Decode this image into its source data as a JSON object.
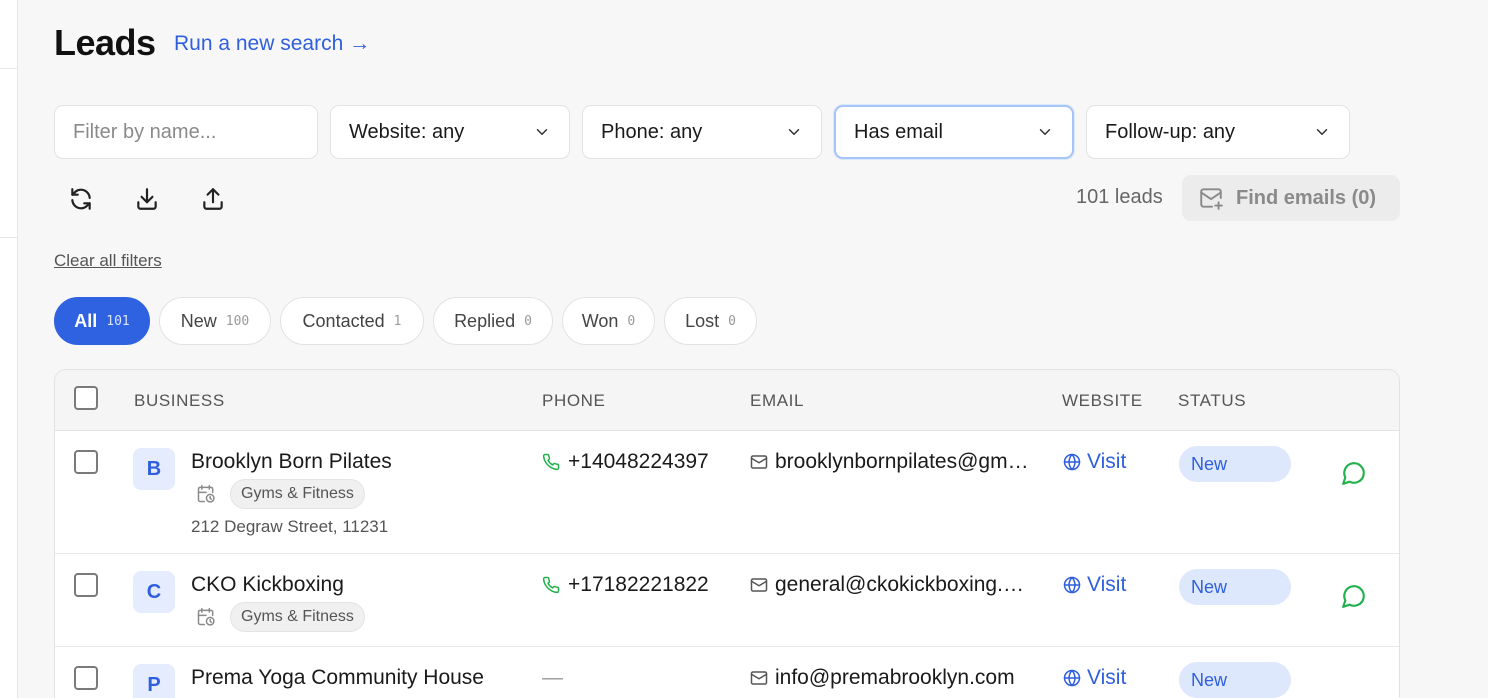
{
  "page": {
    "title": "Leads",
    "run_link": "Run a new search →"
  },
  "filters": {
    "name_placeholder": "Filter by name...",
    "website": "Website: any",
    "phone": "Phone: any",
    "email": "Has email",
    "followup": "Follow-up: any"
  },
  "toolbar": {
    "count": "101 leads",
    "find_emails": "Find emails (0)"
  },
  "clear_filters": "Clear all filters",
  "tabs": [
    {
      "label": "All",
      "count": "101"
    },
    {
      "label": "New",
      "count": "100"
    },
    {
      "label": "Contacted",
      "count": "1"
    },
    {
      "label": "Replied",
      "count": "0"
    },
    {
      "label": "Won",
      "count": "0"
    },
    {
      "label": "Lost",
      "count": "0"
    }
  ],
  "table": {
    "headers": {
      "business": "BUSINESS",
      "phone": "PHONE",
      "email": "EMAIL",
      "website": "WEBSITE",
      "status": "STATUS"
    },
    "rows": [
      {
        "initial": "B",
        "name": "Brooklyn Born Pilates",
        "category": "Gyms & Fitness",
        "address": "212 Degraw Street, 11231",
        "phone": "+14048224397",
        "email": "brooklynbornpilates@gmail.com",
        "website": "Visit",
        "status": "New"
      },
      {
        "initial": "C",
        "name": "CKO Kickboxing",
        "category": "Gyms & Fitness",
        "address": "",
        "phone": "+17182221822",
        "email": "general@ckokickboxing.com",
        "website": "Visit",
        "status": "New"
      },
      {
        "initial": "P",
        "name": "Prema Yoga Community House",
        "category": "",
        "address": "",
        "phone": "—",
        "email": "info@premabrooklyn.com",
        "website": "Visit",
        "status": "New"
      }
    ]
  },
  "colors": {
    "accent": "#2f62e0",
    "status_bg": "#dde8fd",
    "whatsapp": "#22b14c"
  },
  "icons": [
    "refresh-icon",
    "download-icon",
    "upload-icon",
    "mail-plus-icon",
    "chevron-down-icon",
    "phone-icon",
    "mail-icon",
    "globe-icon",
    "calendar-clock-icon",
    "chat-icon"
  ]
}
